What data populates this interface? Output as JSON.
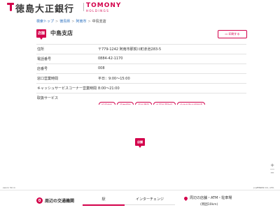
{
  "header": {
    "bank_name": "徳島大正銀行",
    "holdings_brand": "TOMONY",
    "holdings_sub": "HOLDINGS"
  },
  "breadcrumb": {
    "items": [
      "検索トップ",
      "徳島県",
      "阿南市",
      "中島支店"
    ]
  },
  "branch": {
    "badge": "店舗",
    "name": "中島支店",
    "print_button": "印刷する"
  },
  "info": {
    "rows": [
      {
        "label": "住所",
        "value": "〒779-1242 阿南市那賀川町赤池283-5"
      },
      {
        "label": "電話番号",
        "value": "0884-42-1170"
      },
      {
        "label": "店番号",
        "value": "008"
      },
      {
        "label": "窓口営業時間",
        "value": "平日：9:00～15:00"
      },
      {
        "label": "キャッシュサービスコーナー営業時間",
        "value": "8:00～21:00"
      }
    ],
    "services_label": "取扱サービス",
    "services": [
      "投資信託",
      "資産相談",
      "資金運用",
      "外国為替取扱",
      "住宅金融支援機構"
    ]
  },
  "map": {
    "pin_label": "店舗",
    "zoom_in": "+",
    "zoom_out": "−",
    "scale_text": "zenrin 50 m",
    "copyright": "(c)ZENRIN CO., LTD."
  },
  "bottom": {
    "transit_title": "周辺の交通機関",
    "tab_station": "駅",
    "tab_interchange": "インターチェンジ",
    "nearby_text": "周辺の店舗・ATM・駐車場",
    "nearby_sub": "(周囲10km)"
  },
  "colors": {
    "accent": "#d3004b",
    "link": "#2a6fbf"
  }
}
